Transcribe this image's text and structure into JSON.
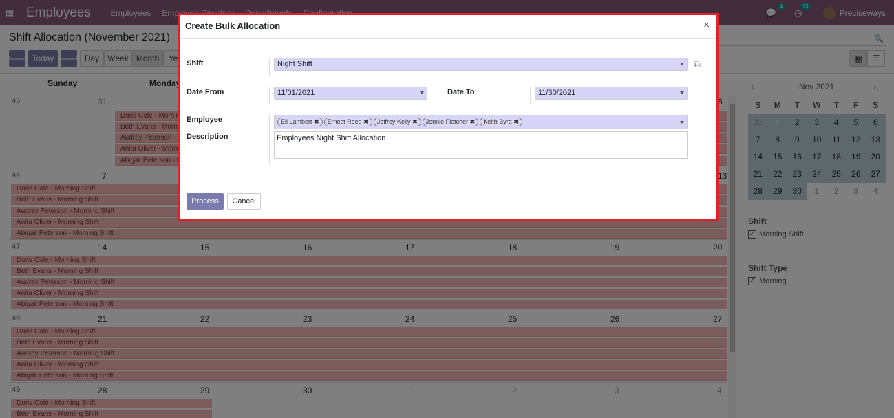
{
  "navbar": {
    "app_name": "Employees",
    "menu": [
      "Employees",
      "Employee Directory",
      "Departments",
      "Configuration"
    ],
    "chat_count": "4",
    "activity_count": "13",
    "user": "Preciseways"
  },
  "control": {
    "title": "Shift Allocation (November 2021)",
    "today": "Today",
    "day": "Day",
    "week": "Week",
    "month": "Month",
    "year": "Year"
  },
  "calendar": {
    "day_headers": [
      "Sunday",
      "Monday"
    ],
    "weeks": [
      {
        "num": "45",
        "days": [
          "31",
          "",
          "",
          "",
          "",
          "",
          "6"
        ]
      },
      {
        "num": "46",
        "days": [
          "7",
          "",
          "",
          "",
          "",
          "",
          "13"
        ]
      },
      {
        "num": "47",
        "days": [
          "14",
          "15",
          "16",
          "17",
          "18",
          "19",
          "20"
        ]
      },
      {
        "num": "48",
        "days": [
          "21",
          "22",
          "23",
          "24",
          "25",
          "26",
          "27"
        ]
      },
      {
        "num": "49",
        "days": [
          "28",
          "29",
          "30",
          "1",
          "2",
          "3",
          "4"
        ]
      }
    ],
    "events": [
      "Doris Cole - Morning Shift",
      "Beth Evans - Morning Shift",
      "Audrey Peterson - Morning Shift",
      "Anita Oliver - Morning Shift",
      "Abigail Peterson - Morning Shift"
    ],
    "events_short": [
      "Doris Cole - Mornin",
      "Beth Evans - Mornin",
      "Audrey Peterson - M",
      "Anita Oliver - Mornin",
      "Abigail Peterson - M"
    ]
  },
  "sidebar": {
    "month_label": "Nov 2021",
    "dow": [
      "S",
      "M",
      "T",
      "W",
      "T",
      "F",
      "S"
    ],
    "rows": [
      [
        "31",
        "1",
        "2",
        "3",
        "4",
        "5",
        "6"
      ],
      [
        "7",
        "8",
        "9",
        "10",
        "11",
        "12",
        "13"
      ],
      [
        "14",
        "15",
        "16",
        "17",
        "18",
        "19",
        "20"
      ],
      [
        "21",
        "22",
        "23",
        "24",
        "25",
        "26",
        "27"
      ],
      [
        "28",
        "29",
        "30",
        "1",
        "2",
        "3",
        "4"
      ]
    ],
    "filters": [
      {
        "title": "Shift",
        "option": "Morning Shift"
      },
      {
        "title": "Shift Type",
        "option": "Morning"
      }
    ]
  },
  "modal": {
    "title": "Create Bulk Allocation",
    "shift_label": "Shift",
    "shift_value": "Night Shift",
    "date_from_label": "Date From",
    "date_from_value": "11/01/2021",
    "date_to_label": "Date To",
    "date_to_value": "11/30/2021",
    "employee_label": "Employee",
    "employees": [
      "Eli Lambert",
      "Ernest Reed",
      "Jeffrey Kelly",
      "Jennie Fletcher",
      "Keith Byrd"
    ],
    "description_label": "Description",
    "description_value": "Employees Night Shift Allocation",
    "process": "Process",
    "cancel": "Cancel"
  },
  "colors": {
    "brand": "#875a7b",
    "primary_btn": "#7c7bad",
    "event": "#f4b8b8",
    "modal_border": "#e0202a",
    "today": "#d9534f"
  }
}
